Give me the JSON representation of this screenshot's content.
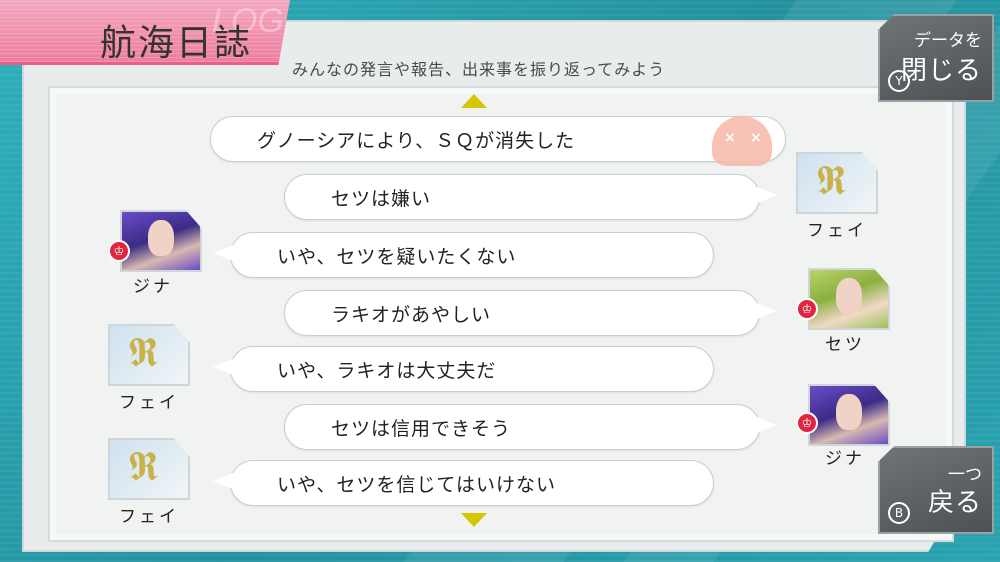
{
  "header": {
    "title": "航海日誌",
    "subtitle": "みんなの発言や報告、出来事を振り返ってみよう"
  },
  "buttons": {
    "close_data": {
      "small": "データを",
      "big": "閉じる",
      "key": "Y"
    },
    "back_one": {
      "small": "一つ",
      "big": "戻る",
      "key": "B"
    }
  },
  "log": [
    {
      "speaker": "",
      "text": "グノーシアにより、ＳＱが消失した",
      "portrait": "system-icon"
    },
    {
      "speaker": "フェイ",
      "text": "セツは嫌い",
      "portrait": "gnosia-emblem"
    },
    {
      "speaker": "ジナ",
      "text": "いや、セツを疑いたくない",
      "portrait": "gina"
    },
    {
      "speaker": "セツ",
      "text": "ラキオがあやしい",
      "portrait": "setsu"
    },
    {
      "speaker": "フェイ",
      "text": "いや、ラキオは大丈夫だ",
      "portrait": "gnosia-emblem"
    },
    {
      "speaker": "ジナ",
      "text": "セツは信用できそう",
      "portrait": "gina"
    },
    {
      "speaker": "フェイ",
      "text": "いや、セツを信じてはいけない",
      "portrait": "gnosia-emblem"
    }
  ],
  "colors": {
    "accent_pink": "#ee7e9f",
    "arrow_yellow": "#d4c700",
    "badge_red": "#e0263f",
    "background_teal": "#2a9aa8"
  }
}
